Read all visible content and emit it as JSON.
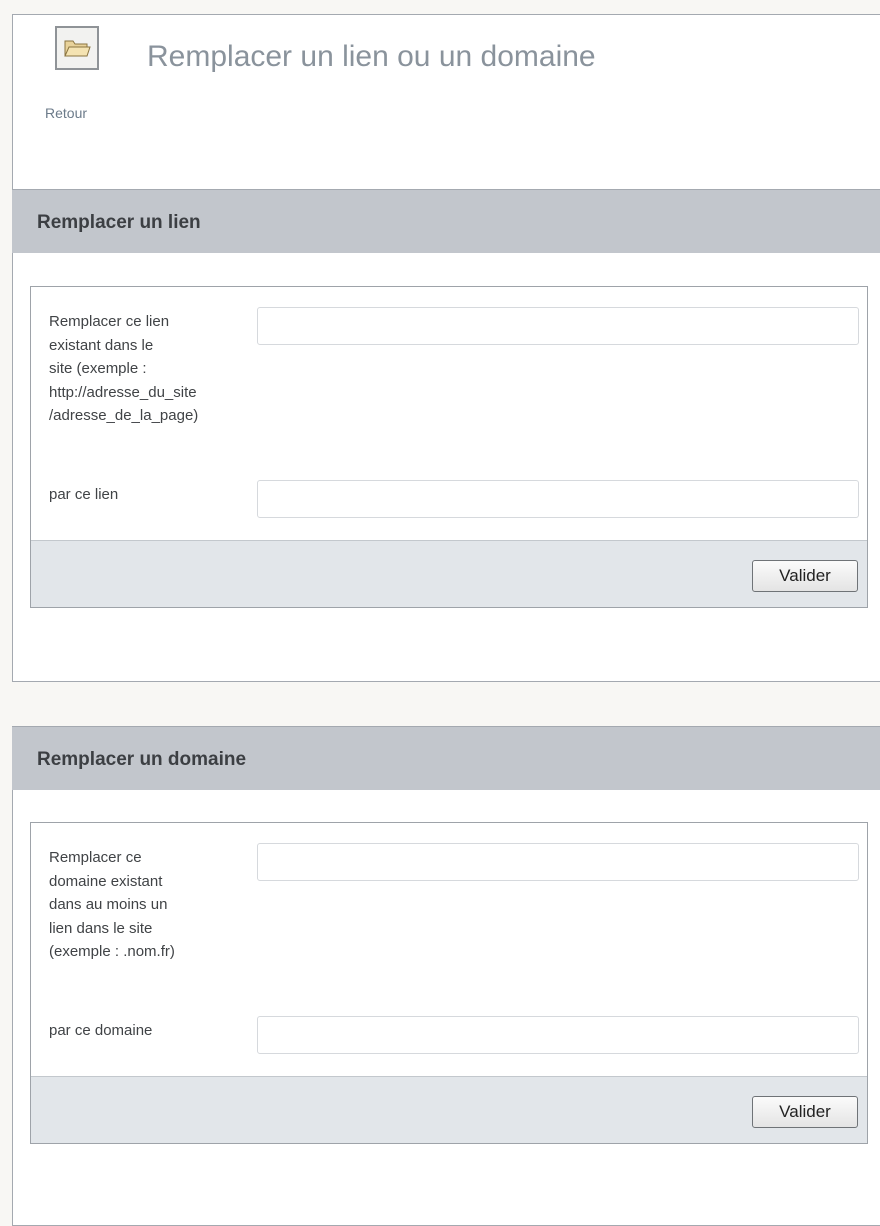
{
  "header": {
    "back_label": "Retour",
    "back_icon": "folder-icon",
    "title": "Remplacer un lien ou un domaine"
  },
  "sections": [
    {
      "title": "Remplacer un lien",
      "fields": [
        {
          "label_lines": [
            "Remplacer ce lien",
            "existant dans le",
            "site (exemple :",
            "http://adresse_du_site",
            "/adresse_de_la_page)"
          ],
          "value": "",
          "placeholder": ""
        },
        {
          "label_lines": [
            "par ce lien"
          ],
          "value": "",
          "placeholder": ""
        }
      ],
      "submit_label": "Valider"
    },
    {
      "title": "Remplacer un domaine",
      "fields": [
        {
          "label_lines": [
            "Remplacer ce",
            "domaine existant",
            "dans au moins un",
            "lien dans le site",
            "(exemple : .nom.fr)"
          ],
          "value": "",
          "placeholder": ""
        },
        {
          "label_lines": [
            "par ce domaine"
          ],
          "value": "",
          "placeholder": ""
        }
      ],
      "submit_label": "Valider"
    }
  ],
  "colors": {
    "section_header_bg": "#c2c6cc",
    "form_footer_bg": "#e2e6ea",
    "title_color": "#8a939c"
  }
}
